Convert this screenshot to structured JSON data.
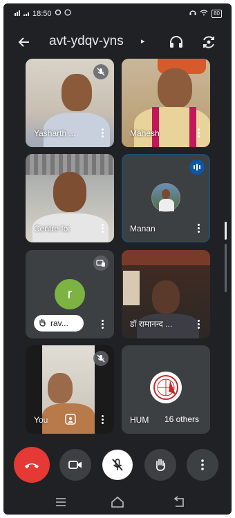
{
  "status_bar": {
    "time": "18:50",
    "battery": "80"
  },
  "header": {
    "meeting_code": "avt-ydqv-yns",
    "caret": "▸"
  },
  "tiles": [
    {
      "name": "Yasharth ...",
      "muted": true
    },
    {
      "name": "Mahesh"
    },
    {
      "name": "Centre for"
    },
    {
      "name": "Manan",
      "speaking": true
    },
    {
      "avatar_letter": "r",
      "hand_raised_label": "rav..."
    },
    {
      "name": "डॉ रामानन्द ..."
    },
    {
      "name": "You",
      "muted": true
    },
    {
      "name": "HUM",
      "others_label": "16 others"
    }
  ],
  "colors": {
    "background": "#202124",
    "tile": "#3c4043",
    "end_call": "#e53935",
    "speaking": "#0b57a5",
    "avatar_r": "#7cb342"
  }
}
